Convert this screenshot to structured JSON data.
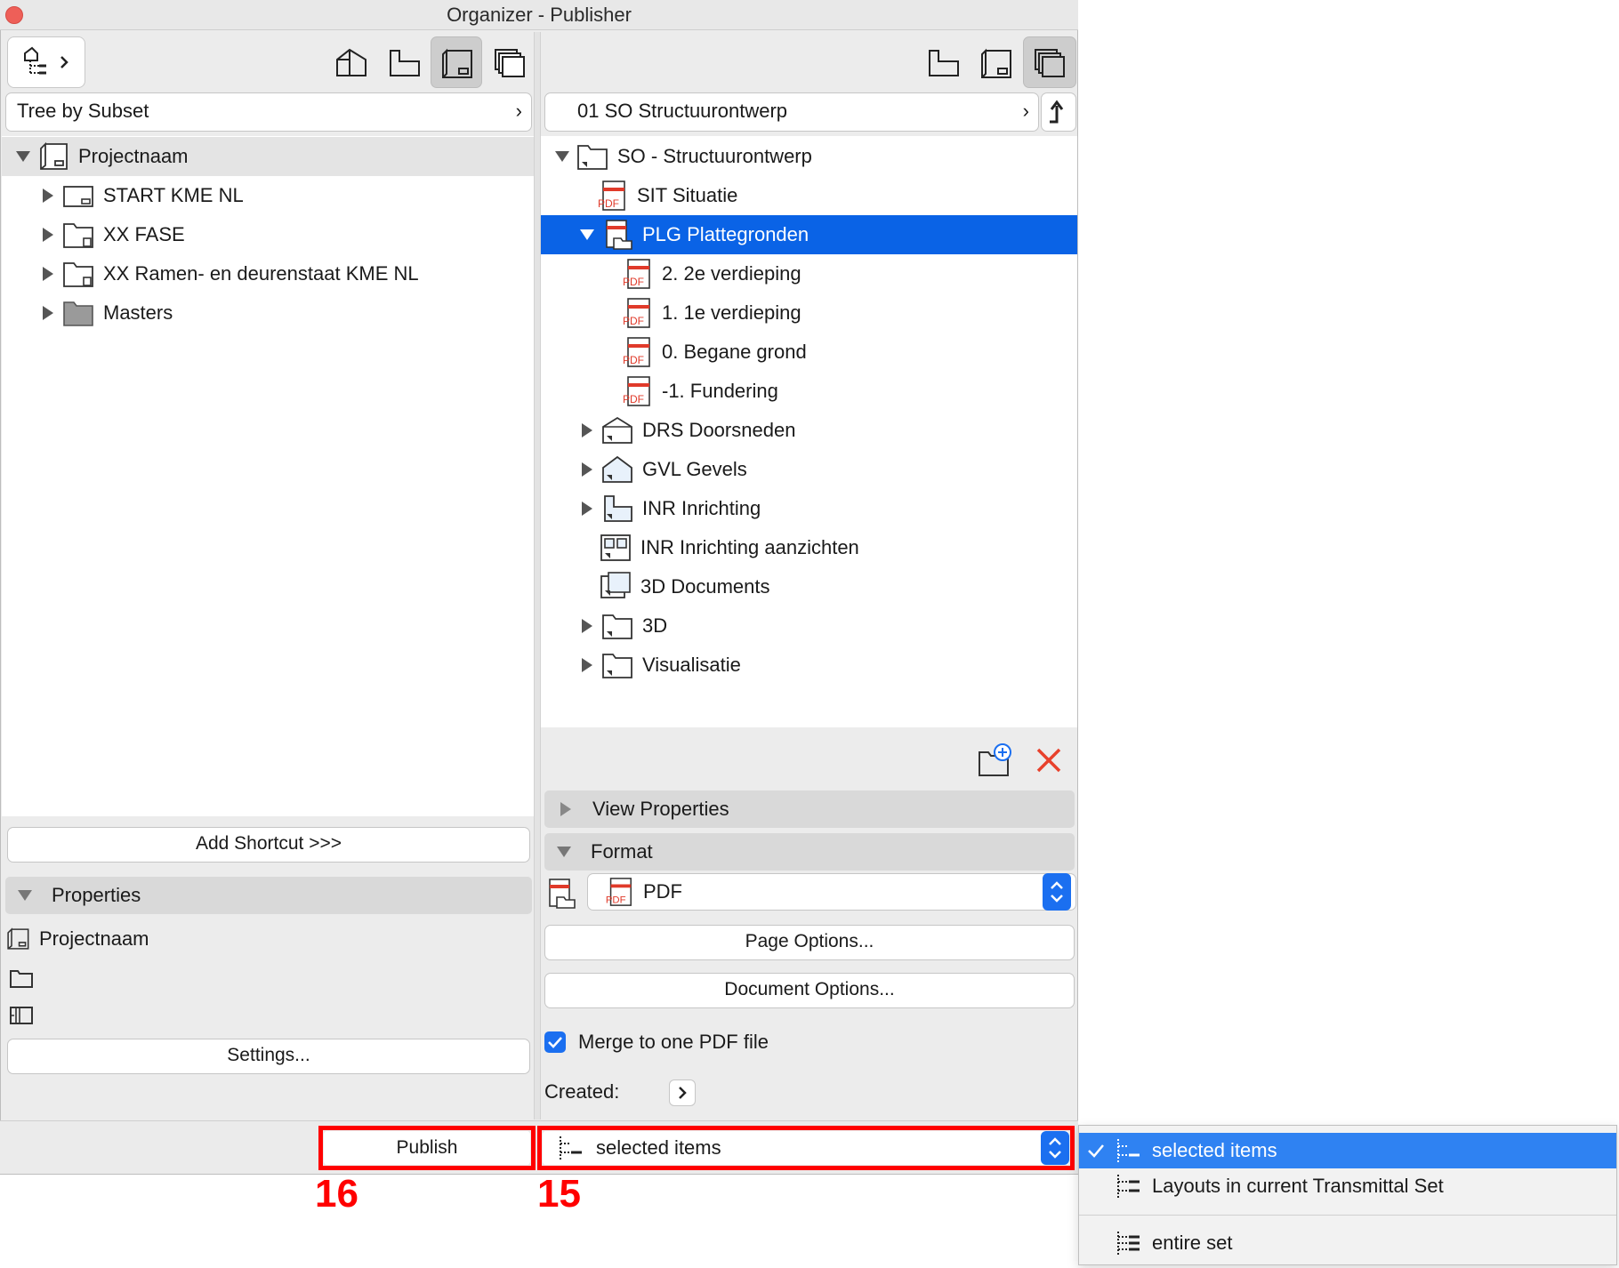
{
  "window": {
    "title": "Organizer - Publisher"
  },
  "left": {
    "mode_dropdown": "Tree by Subset",
    "tree": [
      {
        "label": "Projectnaam",
        "level": 0,
        "expanded": true
      },
      {
        "label": "START KME NL",
        "level": 1
      },
      {
        "label": "XX FASE",
        "level": 1
      },
      {
        "label": "XX Ramen- en deurenstaat KME NL",
        "level": 1
      },
      {
        "label": "Masters",
        "level": 1
      }
    ],
    "add_shortcut": "Add Shortcut >>>",
    "properties_header": "Properties",
    "properties_name": "Projectnaam",
    "settings_button": "Settings..."
  },
  "right": {
    "set_dropdown": "01 SO Structuurontwerp",
    "tree": [
      {
        "label": "SO - Structuurontwerp",
        "level": 0
      },
      {
        "label": "SIT Situatie",
        "level": 1
      },
      {
        "label": "PLG Plattegronden",
        "level": 1,
        "selected": true
      },
      {
        "label": "2. 2e verdieping",
        "level": 2
      },
      {
        "label": "1. 1e verdieping",
        "level": 2
      },
      {
        "label": "0. Begane grond",
        "level": 2
      },
      {
        "label": "-1. Fundering",
        "level": 2
      },
      {
        "label": "DRS Doorsneden",
        "level": 1
      },
      {
        "label": "GVL Gevels",
        "level": 1
      },
      {
        "label": "INR Inrichting",
        "level": 1
      },
      {
        "label": "INR Inrichting aanzichten",
        "level": 1
      },
      {
        "label": "3D Documents",
        "level": 1
      },
      {
        "label": "3D",
        "level": 1
      },
      {
        "label": "Visualisatie",
        "level": 1
      }
    ],
    "view_properties": "View Properties",
    "format_header": "Format",
    "format_value": "PDF",
    "page_options": "Page Options...",
    "document_options": "Document Options...",
    "merge_label": "Merge to one PDF file",
    "merge_checked": true,
    "created_label": "Created:"
  },
  "bottom": {
    "publish_button": "Publish",
    "scope_value": "selected items",
    "callout_publish": "16",
    "callout_scope": "15"
  },
  "dropdown": {
    "items": [
      {
        "label": "selected items",
        "checked": true
      },
      {
        "label": "Layouts in current Transmittal Set"
      },
      {
        "label": "entire set"
      }
    ]
  },
  "colors": {
    "selection": "#0a63e6",
    "dropdown_selection": "#2f82f2",
    "callout_red": "#ff0000",
    "pdf_red": "#e03a2a",
    "delete_red": "#e8412c"
  }
}
